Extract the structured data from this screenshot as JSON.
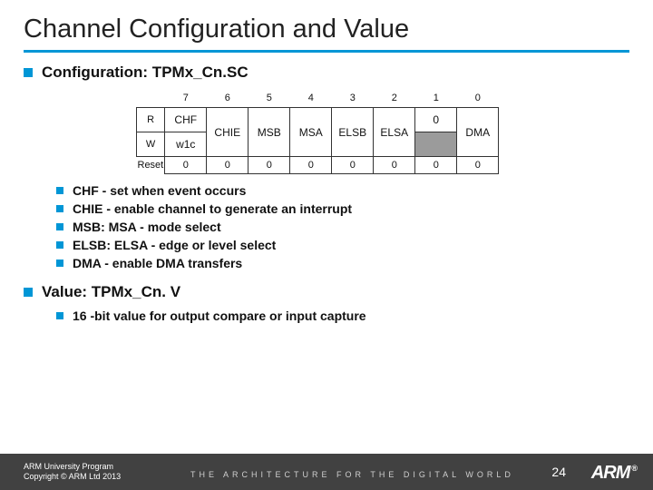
{
  "title": "Channel Configuration and Value",
  "section1": {
    "heading": "Configuration: TPMx_Cn.SC",
    "register": {
      "bit_numbers": [
        "7",
        "6",
        "5",
        "4",
        "3",
        "2",
        "1",
        "0"
      ],
      "row_r": {
        "label": "R",
        "cells": [
          "CHF",
          "CHIE",
          "MSB",
          "MSA",
          "ELSB",
          "ELSA",
          "0",
          "DMA"
        ]
      },
      "row_w": {
        "label": "W",
        "cells": [
          "w1c",
          "",
          "",
          "",
          "",
          "",
          "",
          ""
        ]
      },
      "reset": {
        "label": "Reset",
        "cells": [
          "0",
          "0",
          "0",
          "0",
          "0",
          "0",
          "0",
          "0"
        ]
      }
    },
    "items": [
      "CHF - set when event occurs",
      "CHIE - enable channel to generate an interrupt",
      "MSB: MSA - mode select",
      "ELSB: ELSA - edge or level select",
      "DMA - enable DMA transfers"
    ]
  },
  "section2": {
    "heading": "Value: TPMx_Cn. V",
    "items": [
      "16 -bit value for output compare or input capture"
    ]
  },
  "footer": {
    "line1": "ARM University Program",
    "line2": "Copyright © ARM Ltd 2013",
    "tagline": "THE ARCHITECTURE FOR THE DIGITAL WORLD",
    "page": "24",
    "logo": "ARM",
    "reg": "®"
  }
}
